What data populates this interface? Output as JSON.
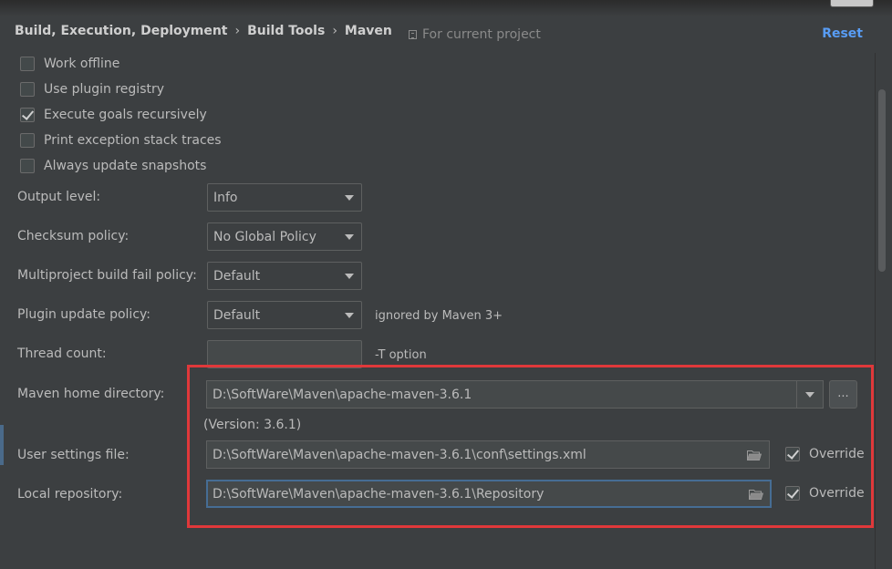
{
  "header": {
    "breadcrumb": [
      "Build, Execution, Deployment",
      "Build Tools",
      "Maven"
    ],
    "breadcrumb_separator": "›",
    "scope_label": "For current project",
    "reset_label": "Reset"
  },
  "checkboxes": [
    {
      "label": "Work offline",
      "checked": false
    },
    {
      "label": "Use plugin registry",
      "checked": false
    },
    {
      "label": "Execute goals recursively",
      "checked": true
    },
    {
      "label": "Print exception stack traces",
      "checked": false
    },
    {
      "label": "Always update snapshots",
      "checked": false
    }
  ],
  "fields": {
    "output_level": {
      "label": "Output level:",
      "value": "Info"
    },
    "checksum_policy": {
      "label": "Checksum policy:",
      "value": "No Global Policy"
    },
    "fail_policy": {
      "label": "Multiproject build fail policy:",
      "value": "Default"
    },
    "plugin_update_policy": {
      "label": "Plugin update policy:",
      "value": "Default",
      "hint": "ignored by Maven 3+"
    },
    "thread_count": {
      "label": "Thread count:",
      "value": "",
      "hint": "-T option"
    }
  },
  "maven": {
    "home_label": "Maven home directory:",
    "home_value": "D:\\SoftWare\\Maven\\apache-maven-3.6.1",
    "browse_label": "...",
    "version_text": "(Version: 3.6.1)",
    "settings_label": "User settings file:",
    "settings_value": "D:\\SoftWare\\Maven\\apache-maven-3.6.1\\conf\\settings.xml",
    "settings_override_label": "Override",
    "settings_override_checked": true,
    "repo_label": "Local repository:",
    "repo_value": "D:\\SoftWare\\Maven\\apache-maven-3.6.1\\Repository",
    "repo_override_label": "Override",
    "repo_override_checked": true
  },
  "colors": {
    "background": "#3c3f41",
    "text": "#bbbbbb",
    "link": "#589df6",
    "highlight": "#e0383a",
    "focus_border": "#466d94"
  },
  "icons": [
    "copy-icon",
    "chevron-down-icon",
    "folder-icon",
    "checkmark-icon"
  ]
}
